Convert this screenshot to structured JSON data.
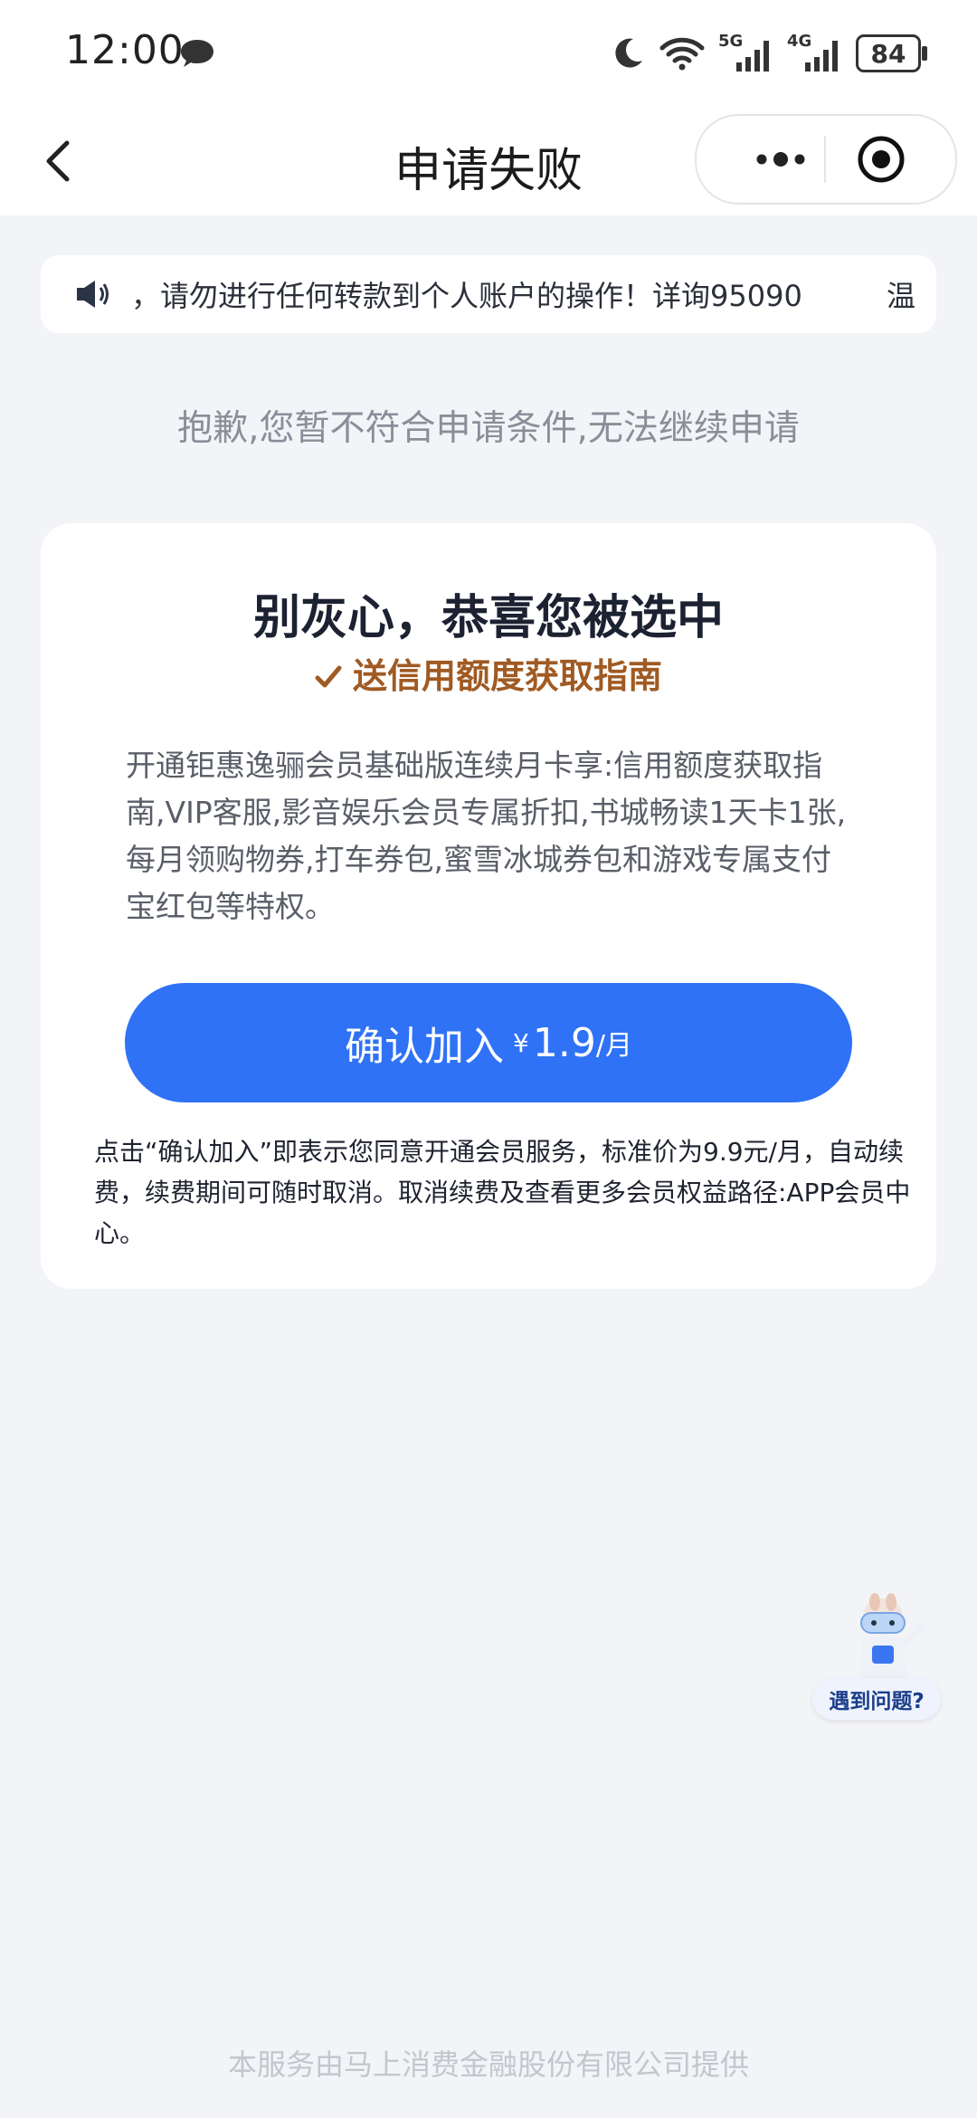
{
  "status_bar": {
    "time": "12:00",
    "network_5g": "5G",
    "network_4g": "4G",
    "battery": "84"
  },
  "nav": {
    "title": "申请失败"
  },
  "notice": {
    "text": "，请勿进行任何转款到个人账户的操作！详询95090",
    "tail": "温"
  },
  "sorry_text": "抱歉,您暂不符合申请条件,无法继续申请",
  "card": {
    "title": "别灰心，恭喜您被选中",
    "subtitle": "送信用额度获取指南",
    "description": "开通钜惠逸骊会员基础版连续月卡享:信用额度获取指南,VIP客服,影音娱乐会员专属折扣,书城畅读1天卡1张,每月领购物券,打车券包,蜜雪冰城券包和游戏专属支付宝红包等特权。",
    "button_label": "确认加入",
    "button_currency": "¥",
    "button_price": "1.9",
    "button_unit": "/月",
    "terms": "点击“确认加入”即表示您同意开通会员服务，标准价为9.9元/月，自动续费，续费期间可随时取消。取消续费及查看更多会员权益路径:APP会员中心。"
  },
  "help": {
    "label": "遇到问题?"
  },
  "footer": "本服务由马上消费金融股份有限公司提供",
  "colors": {
    "accent_button": "#2f72f6",
    "subtitle": "#a05a22",
    "background": "#f3f4f7"
  }
}
